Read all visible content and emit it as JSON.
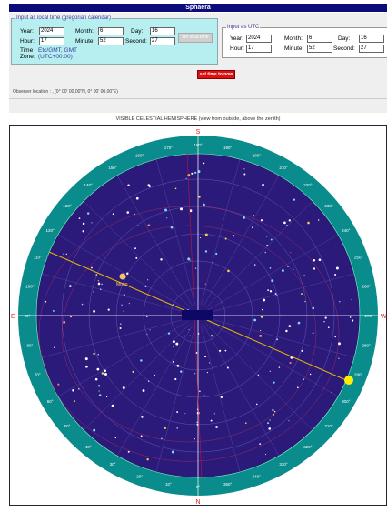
{
  "app": {
    "title": "Sphaera"
  },
  "local": {
    "legend": "Input as local time (gregorian calendar)",
    "year_label": "Year:",
    "year": "2024",
    "month_label": "Month:",
    "month": "6",
    "day_label": "Day:",
    "day": "16",
    "hour_label": "Hour:",
    "hour": "17",
    "minute_label": "Minute:",
    "minute": "52",
    "second_label": "Second:",
    "second": "27",
    "tz_label": "Time Zone:",
    "tz_value": "Etc/GMT, GMT (UTC+00:00)",
    "set_button": "set local time"
  },
  "utc": {
    "legend": "Input as UTC",
    "year_label": "Year:",
    "year": "2024",
    "month_label": "Month:",
    "month": "6",
    "day_label": "Day:",
    "day": "16",
    "hour_label": "Hour:",
    "hour": "17",
    "minute_label": "Minute:",
    "minute": "52",
    "second_label": "Second:",
    "second": "27"
  },
  "now_button": "set time to now",
  "observer": "Observer location : , (0° 00' 00.00\"N, 0° 00' 00.00\"E)",
  "sky": {
    "caption": "VISIBLE CELESTIAL HEMISPHERE (view from outside, above the zenith)",
    "cardinals": {
      "north": "N",
      "south": "S",
      "east": "E",
      "west": "W"
    },
    "azimuth_labels": [
      "0°",
      "10°",
      "20°",
      "30°",
      "40°",
      "50°",
      "60°",
      "70°",
      "80°",
      "90°",
      "100°",
      "110°",
      "120°",
      "130°",
      "140°",
      "150°",
      "160°",
      "170°",
      "180°",
      "190°",
      "200°",
      "210°",
      "220°",
      "230°",
      "240°",
      "250°",
      "260°",
      "270°",
      "280°",
      "290°",
      "300°",
      "310°",
      "320°",
      "330°",
      "340°",
      "350°"
    ],
    "moon_label": "Moon",
    "sun_label": "Sun",
    "colors": {
      "sky": "#2c1a7a",
      "ring": "#0b8c8c",
      "rim": "#6aa",
      "ecliptic": "#e6b800"
    }
  }
}
